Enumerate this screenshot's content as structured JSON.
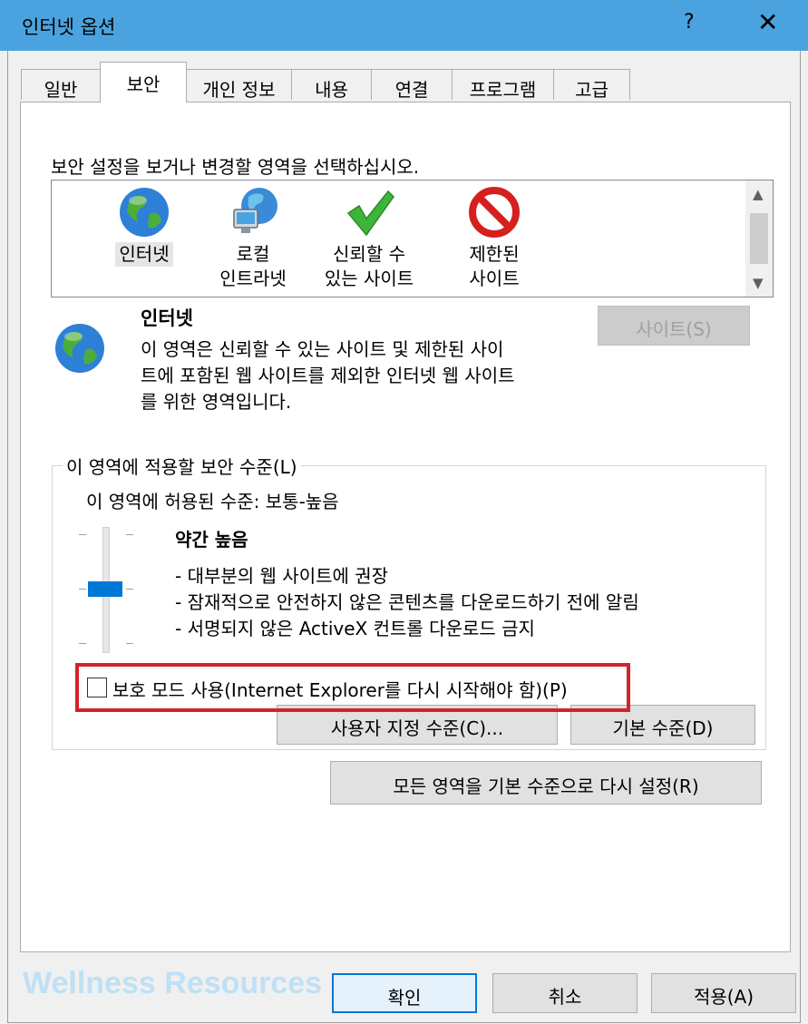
{
  "window": {
    "title": "인터넷 옵션",
    "help": "?",
    "close": "✕"
  },
  "tabs": [
    "일반",
    "보안",
    "개인 정보",
    "내용",
    "연결",
    "프로그램",
    "고급"
  ],
  "instruction": "보안 설정을 보거나 변경할 영역을 선택하십시오.",
  "zones": [
    {
      "line1": "인터넷",
      "line2": ""
    },
    {
      "line1": "로컬",
      "line2": "인트라넷"
    },
    {
      "line1": "신뢰할 수",
      "line2": "있는 사이트"
    },
    {
      "line1": "제한된",
      "line2": "사이트"
    }
  ],
  "zone_detail": {
    "name": "인터넷",
    "desc1": "이 영역은 신뢰할 수 있는 사이트 및 제한된 사이",
    "desc2": "트에 포함된 웹 사이트를 제외한 인터넷 웹 사이트",
    "desc3": "를 위한 영역입니다.",
    "sites_button": "사이트(S)"
  },
  "security_level": {
    "group_label": "이 영역에 적용할 보안 수준(L)",
    "allowed": "이 영역에 허용된 수준: 보통-높음",
    "level_name": "약간 높음",
    "bullets": [
      "- 대부분의 웹 사이트에 권장",
      "- 잠재적으로 안전하지 않은 콘텐츠를 다운로드하기 전에 알림",
      "- 서명되지 않은 ActiveX 컨트롤 다운로드 금지"
    ],
    "slider_position": "medium-high"
  },
  "protected_mode": {
    "label": "보호 모드 사용(Internet Explorer를 다시 시작해야 함)(P)",
    "checked": false
  },
  "buttons": {
    "custom_level": "사용자 지정 수준(C)...",
    "default_level": "기본 수준(D)",
    "reset_all": "모든 영역을 기본 수준으로 다시 설정(R)",
    "ok": "확인",
    "cancel": "취소",
    "apply": "적용(A)"
  },
  "watermark": "Wellness Resources",
  "colors": {
    "title_bar": "#4aa3df",
    "accent": "#0078d7",
    "highlight": "#d2232a"
  }
}
